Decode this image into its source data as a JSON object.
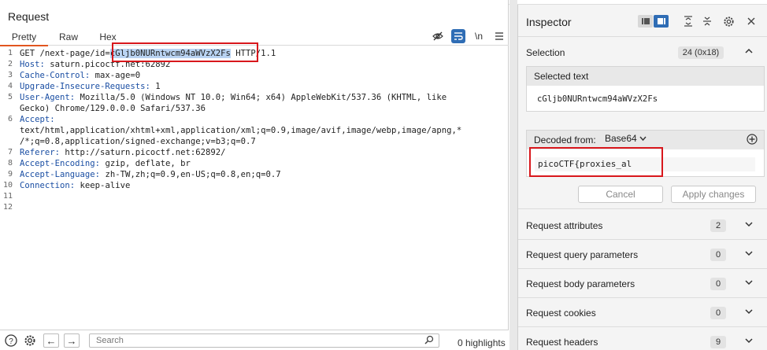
{
  "request": {
    "title": "Request",
    "tabs": [
      "Pretty",
      "Raw",
      "Hex"
    ],
    "toolbar": {
      "hide_icon": "eye-off-icon",
      "wrap_icon": "wrap-lines-icon",
      "newline_label": "\\n",
      "menu_icon": "menu-icon"
    },
    "lines": [
      {
        "n": "1",
        "a": "GET /next-page/id=",
        "b": "cGljb0NURntwcm94aWVzX2Fs",
        "c": " HTTP/1.1"
      },
      {
        "n": "2",
        "h": "Host:",
        "v": " saturn.picoctf.net:62892"
      },
      {
        "n": "3",
        "h": "Cache-Control:",
        "v": " max-age=0"
      },
      {
        "n": "4",
        "h": "Upgrade-Insecure-Requests:",
        "v": " 1"
      },
      {
        "n": "5",
        "h": "User-Agent:",
        "v": " Mozilla/5.0 (Windows NT 10.0; Win64; x64) AppleWebKit/537.36 (KHTML, like"
      },
      {
        "n": "",
        "v": "Gecko) Chrome/129.0.0.0 Safari/537.36"
      },
      {
        "n": "6",
        "h": "Accept:",
        "v": ""
      },
      {
        "n": "",
        "v": "text/html,application/xhtml+xml,application/xml;q=0.9,image/avif,image/webp,image/apng,*"
      },
      {
        "n": "",
        "v": "/*;q=0.8,application/signed-exchange;v=b3;q=0.7"
      },
      {
        "n": "7",
        "h": "Referer:",
        "v": " http://saturn.picoctf.net:62892/"
      },
      {
        "n": "8",
        "h": "Accept-Encoding:",
        "v": " gzip, deflate, br"
      },
      {
        "n": "9",
        "h": "Accept-Language:",
        "v": " zh-TW,zh;q=0.9,en-US;q=0.8,en;q=0.7"
      },
      {
        "n": "10",
        "h": "Connection:",
        "v": " keep-alive"
      },
      {
        "n": "11",
        "v": ""
      },
      {
        "n": "12",
        "v": ""
      }
    ]
  },
  "bottom": {
    "search_placeholder": "Search",
    "highlights": "0 highlights"
  },
  "inspector": {
    "title": "Inspector",
    "selection": {
      "label": "Selection",
      "badge": "24 (0x18)"
    },
    "selected_text": {
      "label": "Selected text",
      "value": "cGljb0NURntwcm94aWVzX2Fs"
    },
    "decoded": {
      "label": "Decoded from:",
      "encoding": "Base64",
      "value": "picoCTF{proxies_al"
    },
    "buttons": {
      "cancel": "Cancel",
      "apply": "Apply changes"
    },
    "sections": [
      {
        "label": "Request attributes",
        "count": "2"
      },
      {
        "label": "Request query parameters",
        "count": "0"
      },
      {
        "label": "Request body parameters",
        "count": "0"
      },
      {
        "label": "Request cookies",
        "count": "0"
      },
      {
        "label": "Request headers",
        "count": "9"
      }
    ]
  },
  "colors": {
    "accent": "#e2561f",
    "highlight_box": "#d8171c",
    "selection_bg": "#b9d3f2",
    "header_name": "#1a4ea3"
  }
}
